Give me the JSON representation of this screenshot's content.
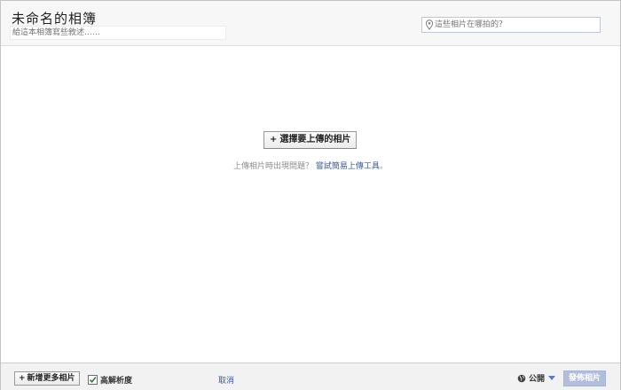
{
  "header": {
    "album_title": "未命名的相簿",
    "description_placeholder": "給這本相簿寫些敘述……",
    "location_placeholder": "這些相片在哪拍的？",
    "location_icon": "map-pin-icon"
  },
  "main": {
    "choose_button_label": "選擇要上傳的相片",
    "help_text": "上傳相片時出現問題？",
    "help_link": "嘗試簡易上傳工具",
    "help_suffix": "。"
  },
  "footer": {
    "add_more_label": "新增更多相片",
    "high_res_label": "高解析度",
    "high_res_checked": true,
    "cancel_label": "取消",
    "privacy_label": "公開",
    "privacy_icon": "globe-icon",
    "post_label": "發佈相片"
  },
  "colors": {
    "link": "#3b5998",
    "post_button_disabled": "#b2bfdc",
    "header_bg": "#f7f7f7",
    "footer_bg": "#f2f2f2"
  }
}
